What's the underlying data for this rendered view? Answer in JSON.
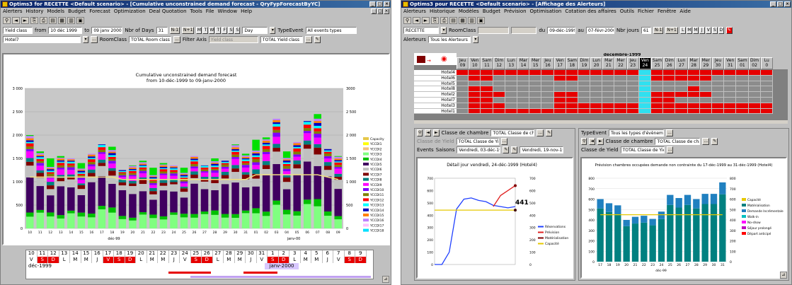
{
  "left": {
    "title": "Optims3 for RECETTE <Default scenario> - [Cumulative unconstrained demand forecast - QryFypForecastByYC]",
    "menu": [
      "Alerters",
      "History",
      "Models",
      "Budget",
      "Forecast",
      "Optimization",
      "Deal Quotation",
      "Tools",
      "File",
      "Window",
      "Help"
    ],
    "filter1": {
      "yield_class": "Yield class",
      "from_label": "from",
      "from_value": "10 déc 1999",
      "to_label": "to",
      "to_value": "09 janv 2000",
      "nbr_days_label": "Nbr of Days",
      "nbr_days_value": "31",
      "n1": "N-1",
      "n1b": "N+1",
      "days": [
        "M",
        "T",
        "W",
        "T",
        "F",
        "S",
        "S"
      ],
      "period": "Day",
      "type_event_label": "TypeEvent",
      "type_event_value": "All events types"
    },
    "filter2": {
      "hotel": "Hotel7",
      "room_class_label": "RoomClass",
      "room_class_value": "TOTAL Room class",
      "filter_axis_label": "Filter Axis",
      "filter_axis_value": "Yield class",
      "yield_value": "TOTAL Yield class"
    },
    "chart_title_1": "Cumulative unconstrained demand forecast",
    "chart_title_2": "from 10-déc-1999 to 09-janv-2000",
    "y_left_ticks": [
      "3 000",
      "2 500",
      "2 000",
      "1 500",
      "1 000",
      "500",
      "0"
    ],
    "y_right_ticks": [
      "3000",
      "2 500",
      "2 000",
      "1 500",
      "1 000",
      "500",
      "0"
    ],
    "x_ticks": [
      "10",
      "11",
      "12",
      "13",
      "14",
      "15",
      "16",
      "17",
      "18",
      "19",
      "20",
      "21",
      "22",
      "23",
      "24",
      "25",
      "26",
      "27",
      "28",
      "29",
      "30",
      "31",
      "01",
      "02",
      "03",
      "04",
      "05",
      "06",
      "07",
      "08",
      "09"
    ],
    "month_labels": [
      "déc-99",
      "janv-00"
    ],
    "legend": [
      {
        "name": "Capacity",
        "color": "#e6c84a"
      },
      {
        "name": "YCCDI1",
        "color": "#ffff00"
      },
      {
        "name": "YCCDI2",
        "color": "#f4c080"
      },
      {
        "name": "YCCDI3",
        "color": "#80ff80"
      },
      {
        "name": "YCCDI4",
        "color": "#00c000"
      },
      {
        "name": "YCCDI5",
        "color": "#400060"
      },
      {
        "name": "YCCDI6",
        "color": "#c0c0c0"
      },
      {
        "name": "YCCDI7",
        "color": "#800000"
      },
      {
        "name": "YCCDI8",
        "color": "#008080"
      },
      {
        "name": "YCCDI9",
        "color": "#ff00ff"
      },
      {
        "name": "YCCDI10",
        "color": "#8000ff"
      },
      {
        "name": "YCCDI11",
        "color": "#808000"
      },
      {
        "name": "YCCDI12",
        "color": "#ff0000"
      },
      {
        "name": "YCCDI13",
        "color": "#00ffff"
      },
      {
        "name": "YCCDI14",
        "color": "#0000c0"
      },
      {
        "name": "YCCDI15",
        "color": "#ff8000"
      },
      {
        "name": "YCCDI16",
        "color": "#c080ff"
      },
      {
        "name": "YCCDI17",
        "color": "#ffc0ff"
      },
      {
        "name": "YCCDI18",
        "color": "#00e0ff"
      }
    ],
    "cal_days": [
      "10",
      "11",
      "12",
      "13",
      "14",
      "15",
      "16",
      "17",
      "18",
      "19",
      "20",
      "21",
      "22",
      "23",
      "24",
      "25",
      "26",
      "27",
      "28",
      "29",
      "30",
      "31",
      "1",
      "2",
      "3",
      "4",
      "5",
      "6",
      "7",
      "8",
      "9"
    ],
    "cal_weekdays": [
      "V",
      "S",
      "D",
      "L",
      "M",
      "M",
      "J",
      "V",
      "S",
      "D",
      "L",
      "M",
      "M",
      "J",
      "V",
      "S",
      "D",
      "L",
      "M",
      "M",
      "J",
      "V",
      "S",
      "D",
      "L",
      "M",
      "M",
      "J",
      "V",
      "S",
      "D"
    ],
    "cal_month_1": "déc-1999",
    "cal_month_2": "janv-2000"
  },
  "right": {
    "title": "Optims3 pour RECETTE <Default scenario> - [Affichage des Alerteurs]",
    "menu": [
      "Alerteurs",
      "Historique",
      "Modèles",
      "Budget",
      "Prévision",
      "Optimisation",
      "Cotation des affaires",
      "Outils",
      "Fichier",
      "Fenêtre",
      "Aide"
    ],
    "filter1": {
      "recette": "RECETTE",
      "room_class_label": "RoomClass",
      "du_label": "du",
      "du_value": "09-déc-1999",
      "au_label": "au",
      "au_value": "07-févr-2000",
      "nbr_jours_label": "Nbr jours",
      "nbr_jours_value": "61",
      "n1": "N-1",
      "n1b": "N+1",
      "days": [
        "L",
        "M",
        "M",
        "J",
        "V",
        "S",
        "D"
      ]
    },
    "alerteurs_label": "Alerteurs",
    "alerteurs_value": "Tous les Alerteurs",
    "grid_month": "décembre-1999",
    "grid_days": [
      {
        "wd": "Jeu",
        "d": "09"
      },
      {
        "wd": "Ven",
        "d": "10"
      },
      {
        "wd": "Sam",
        "d": "11"
      },
      {
        "wd": "Dim",
        "d": "12"
      },
      {
        "wd": "Lun",
        "d": "13"
      },
      {
        "wd": "Mar",
        "d": "14"
      },
      {
        "wd": "Mer",
        "d": "15"
      },
      {
        "wd": "Jeu",
        "d": "16"
      },
      {
        "wd": "Ven",
        "d": "17"
      },
      {
        "wd": "Sam",
        "d": "18"
      },
      {
        "wd": "Dim",
        "d": "19"
      },
      {
        "wd": "Lun",
        "d": "20"
      },
      {
        "wd": "Mar",
        "d": "21"
      },
      {
        "wd": "Mer",
        "d": "22"
      },
      {
        "wd": "Jeu",
        "d": "23"
      },
      {
        "wd": "Ven",
        "d": "24"
      },
      {
        "wd": "Sam",
        "d": "25"
      },
      {
        "wd": "Dim",
        "d": "26"
      },
      {
        "wd": "Lun",
        "d": "27"
      },
      {
        "wd": "Mar",
        "d": "28"
      },
      {
        "wd": "Mer",
        "d": "29"
      },
      {
        "wd": "Jeu",
        "d": "30"
      },
      {
        "wd": "Ven",
        "d": "31"
      },
      {
        "wd": "Sam",
        "d": "01"
      },
      {
        "wd": "Dim",
        "d": "02"
      },
      {
        "wd": "Lu",
        "d": "0"
      }
    ],
    "hotels": [
      "Hotel4",
      "Hotel6",
      "Hotel5",
      "Hotel8",
      "Hotel2",
      "Hotel7",
      "Hotel3",
      "Hotel1"
    ],
    "grid_pattern": [
      "RRRRRRRRRRRRRRRCRRRRRRRRRR",
      "GRRGGGGGRRGGGGGCRRRRRGGGGG",
      "GGGGGGGGGGGGGGGCGGGGGGGGGG",
      "GRRGGGGGGGGGGGGCGGGRGGGGGG",
      "GRRRGGGGRRGGGGGCRRRRRGGGGG",
      "GRRGGGGGRRGGGGGCRRGGGGGGGG",
      "GRRRGGGGRRRRRRRCRRRRRRRRRR",
      "GRRRRRRRRRRRRRRCRRRRRRRRRR"
    ],
    "sub1": {
      "room_label": "Classe de chambre",
      "room_value": "TOTAL Classe de chambre",
      "yield_label": "Classe de Yield",
      "yield_value": "TOTAL Classe de Yield",
      "events_label": "Events",
      "saisons_label": "Saisons",
      "date1": "Vendredi, 03-déc-1999",
      "date2": "Vendredi, 19-nov-1999",
      "chart_title": "Détail jour vendredi, 24-déc-1999 (Hotel4)",
      "y_left": [
        "700",
        "600",
        "500",
        "400",
        "300",
        "200",
        "100",
        "0"
      ],
      "y_right": [
        "700",
        "600",
        "500",
        "400",
        "300",
        "200",
        "100",
        "0"
      ],
      "highlight_value": "441",
      "legend": [
        {
          "name": "Réservations",
          "color": "#2040ff"
        },
        {
          "name": "Prévision",
          "color": "#e02020"
        },
        {
          "name": "Matérialisation",
          "color": "#800000"
        },
        {
          "name": "Capacité",
          "color": "#e6c800"
        }
      ]
    },
    "sub2": {
      "type_event_label": "TypeEvent",
      "type_event_value": "Tous les types d'évènements",
      "room_label": "Classe de chambre",
      "room_value": "TOTAL Classe de chambre",
      "yield_label": "Classe de Yield",
      "yield_value": "TOTAL Classe de Yield",
      "chart_title": "Prévision chambres occupées demande non contrainte du 17-déc-1999 au 31-déc-1999 (Hotel4)",
      "y_left": [
        "800",
        "700",
        "600",
        "500",
        "400",
        "300",
        "200",
        "100",
        "0"
      ],
      "y_right": [
        "800",
        "700",
        "600",
        "500",
        "400",
        "300",
        "200",
        "100",
        "0"
      ],
      "x_ticks": [
        "17",
        "18",
        "19",
        "20",
        "21",
        "22",
        "23",
        "24",
        "25",
        "26",
        "27",
        "28",
        "29",
        "30",
        "31"
      ],
      "x_month": "déc-99",
      "legend": [
        {
          "name": "Capacité",
          "color": "#e6c800"
        },
        {
          "name": "Matérialisation",
          "color": "#008080"
        },
        {
          "name": "Demande Incrémentale",
          "color": "#2080c0"
        },
        {
          "name": "Walk-in",
          "color": "#00c0c0"
        },
        {
          "name": "No-show",
          "color": "#ff00ff"
        },
        {
          "name": "Séjour prolongé",
          "color": "#c000c0"
        },
        {
          "name": "Départ anticipé",
          "color": "#ff0000"
        }
      ]
    }
  },
  "chart_data": [
    {
      "type": "bar",
      "title": "Cumulative unconstrained demand forecast",
      "subtitle": "from 10-déc-1999 to 09-janv-2000",
      "categories": [
        "10",
        "11",
        "12",
        "13",
        "14",
        "15",
        "16",
        "17",
        "18",
        "19",
        "20",
        "21",
        "22",
        "23",
        "24",
        "25",
        "26",
        "27",
        "28",
        "29",
        "30",
        "31",
        "01",
        "02",
        "03",
        "04",
        "05",
        "06",
        "07",
        "08",
        "09"
      ],
      "totals": [
        2000,
        1650,
        1500,
        1550,
        1500,
        1400,
        1600,
        1800,
        1750,
        1250,
        1350,
        1450,
        1300,
        1400,
        1350,
        1300,
        1550,
        1350,
        1500,
        1450,
        1800,
        1600,
        1900,
        1950,
        2350,
        1650,
        1850,
        2300,
        2450,
        1700,
        1550
      ],
      "capacity": [
        1100,
        1100,
        1100,
        1100,
        1100,
        1100,
        1100,
        1100,
        1100,
        1050,
        1050,
        1050,
        1050,
        1050,
        1050,
        1050,
        1050,
        1050,
        1050,
        1050,
        1050,
        1050,
        1150,
        1150,
        1150,
        1150,
        1150,
        1150,
        1150,
        1100,
        1050
      ],
      "ylim": [
        0,
        3000
      ]
    },
    {
      "type": "line",
      "title": "Détail jour vendredi, 24-déc-1999 (Hotel4)",
      "series": [
        {
          "name": "Réservations",
          "values": [
            0,
            0,
            100,
            450,
            530,
            540,
            520,
            510,
            480,
            470,
            460,
            470
          ]
        },
        {
          "name": "Prévision",
          "values": [
            null,
            null,
            null,
            null,
            null,
            null,
            null,
            null,
            470,
            560,
            600,
            640
          ]
        },
        {
          "name": "Capacité",
          "values": [
            441,
            441,
            441,
            441,
            441,
            441,
            441,
            441,
            441,
            441,
            441,
            441
          ]
        }
      ],
      "ylim": [
        0,
        700
      ]
    },
    {
      "type": "bar",
      "title": "Prévision chambres occupées demande non contrainte du 17-déc-1999 au 31-déc-1999 (Hotel4)",
      "categories": [
        "17",
        "18",
        "19",
        "20",
        "21",
        "22",
        "23",
        "24",
        "25",
        "26",
        "27",
        "28",
        "29",
        "30",
        "31"
      ],
      "values": [
        600,
        560,
        540,
        400,
        430,
        440,
        410,
        480,
        640,
        610,
        640,
        600,
        650,
        650,
        760
      ],
      "capacity": [
        450,
        450,
        450,
        450,
        450,
        450,
        450,
        450,
        450,
        450,
        450,
        450,
        450,
        450,
        450
      ],
      "ylim": [
        0,
        800
      ]
    }
  ]
}
